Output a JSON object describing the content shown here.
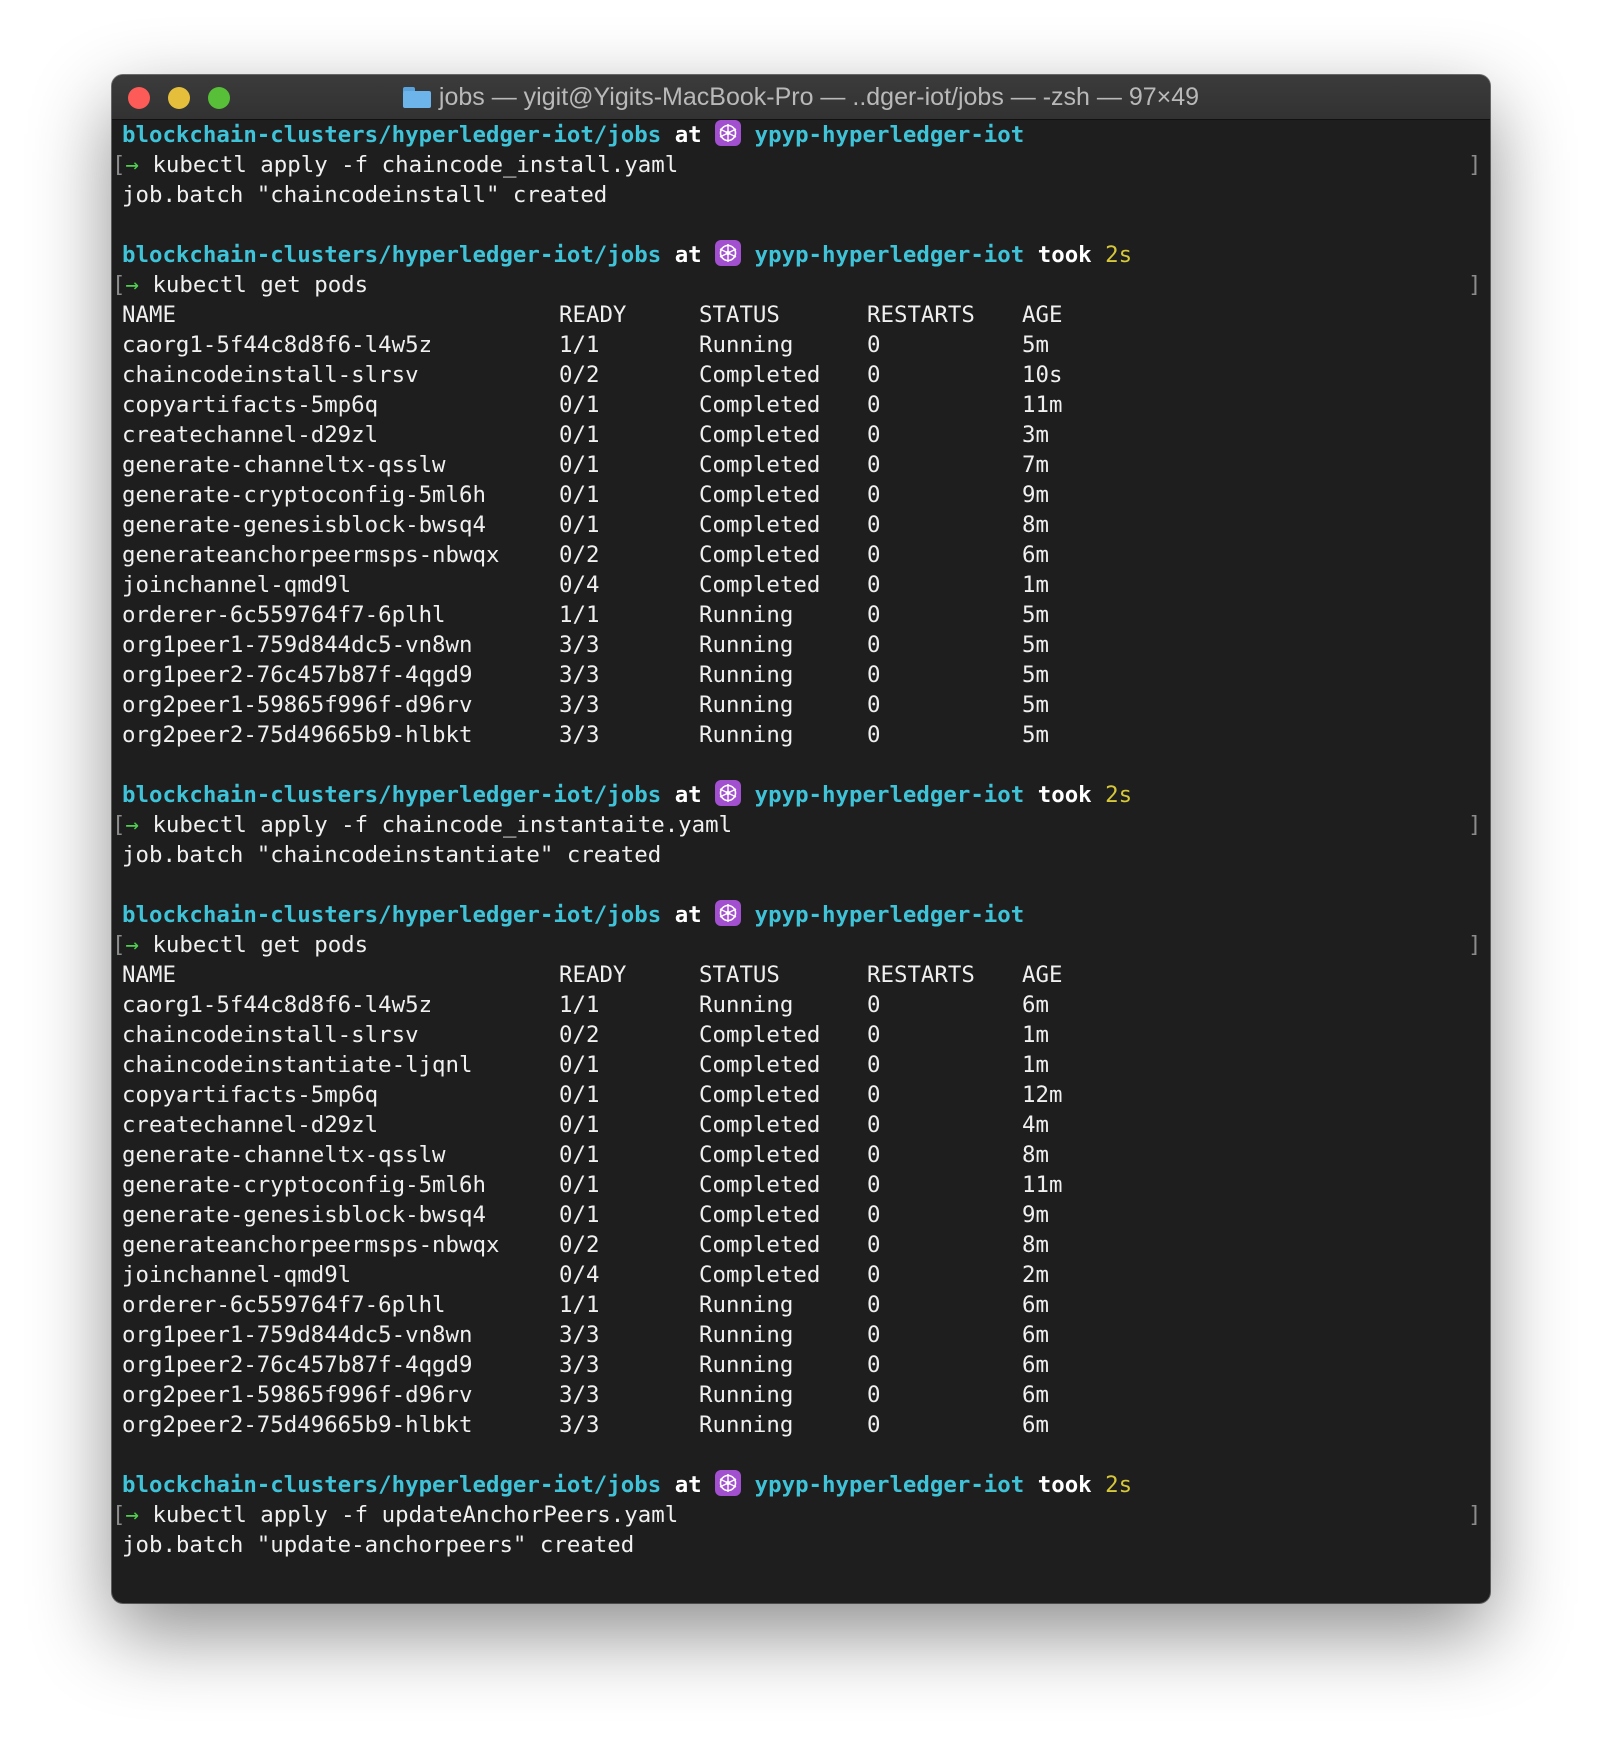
{
  "window": {
    "title": "jobs — yigit@Yigits-MacBook-Pro — ..dger-iot/jobs — -zsh — 97×49",
    "title_icon": "folder-icon"
  },
  "prompt": {
    "path": "blockchain-clusters/hyperledger-iot/jobs",
    "at": "at",
    "context": "ypyp-hyperledger-iot",
    "took": "took",
    "duration": "2s",
    "arrow": "→",
    "context_icon": "kubernetes-icon"
  },
  "table_headers": [
    "NAME",
    "READY",
    "STATUS",
    "RESTARTS",
    "AGE"
  ],
  "blocks": [
    {
      "show_took": false,
      "command": "kubectl apply -f chaincode_install.yaml",
      "output": "job.batch \"chaincodeinstall\" created"
    },
    {
      "show_took": true,
      "command": "kubectl get pods",
      "rows": [
        [
          "caorg1-5f44c8d8f6-l4w5z",
          "1/1",
          "Running",
          "0",
          "5m"
        ],
        [
          "chaincodeinstall-slrsv",
          "0/2",
          "Completed",
          "0",
          "10s"
        ],
        [
          "copyartifacts-5mp6q",
          "0/1",
          "Completed",
          "0",
          "11m"
        ],
        [
          "createchannel-d29zl",
          "0/1",
          "Completed",
          "0",
          "3m"
        ],
        [
          "generate-channeltx-qsslw",
          "0/1",
          "Completed",
          "0",
          "7m"
        ],
        [
          "generate-cryptoconfig-5ml6h",
          "0/1",
          "Completed",
          "0",
          "9m"
        ],
        [
          "generate-genesisblock-bwsq4",
          "0/1",
          "Completed",
          "0",
          "8m"
        ],
        [
          "generateanchorpeermsps-nbwqx",
          "0/2",
          "Completed",
          "0",
          "6m"
        ],
        [
          "joinchannel-qmd9l",
          "0/4",
          "Completed",
          "0",
          "1m"
        ],
        [
          "orderer-6c559764f7-6plhl",
          "1/1",
          "Running",
          "0",
          "5m"
        ],
        [
          "org1peer1-759d844dc5-vn8wn",
          "3/3",
          "Running",
          "0",
          "5m"
        ],
        [
          "org1peer2-76c457b87f-4qgd9",
          "3/3",
          "Running",
          "0",
          "5m"
        ],
        [
          "org2peer1-59865f996f-d96rv",
          "3/3",
          "Running",
          "0",
          "5m"
        ],
        [
          "org2peer2-75d49665b9-hlbkt",
          "3/3",
          "Running",
          "0",
          "5m"
        ]
      ]
    },
    {
      "show_took": true,
      "command": "kubectl apply -f chaincode_instantaite.yaml",
      "output": "job.batch \"chaincodeinstantiate\" created"
    },
    {
      "show_took": false,
      "command": "kubectl get pods",
      "rows": [
        [
          "caorg1-5f44c8d8f6-l4w5z",
          "1/1",
          "Running",
          "0",
          "6m"
        ],
        [
          "chaincodeinstall-slrsv",
          "0/2",
          "Completed",
          "0",
          "1m"
        ],
        [
          "chaincodeinstantiate-ljqnl",
          "0/1",
          "Completed",
          "0",
          "1m"
        ],
        [
          "copyartifacts-5mp6q",
          "0/1",
          "Completed",
          "0",
          "12m"
        ],
        [
          "createchannel-d29zl",
          "0/1",
          "Completed",
          "0",
          "4m"
        ],
        [
          "generate-channeltx-qsslw",
          "0/1",
          "Completed",
          "0",
          "8m"
        ],
        [
          "generate-cryptoconfig-5ml6h",
          "0/1",
          "Completed",
          "0",
          "11m"
        ],
        [
          "generate-genesisblock-bwsq4",
          "0/1",
          "Completed",
          "0",
          "9m"
        ],
        [
          "generateanchorpeermsps-nbwqx",
          "0/2",
          "Completed",
          "0",
          "8m"
        ],
        [
          "joinchannel-qmd9l",
          "0/4",
          "Completed",
          "0",
          "2m"
        ],
        [
          "orderer-6c559764f7-6plhl",
          "1/1",
          "Running",
          "0",
          "6m"
        ],
        [
          "org1peer1-759d844dc5-vn8wn",
          "3/3",
          "Running",
          "0",
          "6m"
        ],
        [
          "org1peer2-76c457b87f-4qgd9",
          "3/3",
          "Running",
          "0",
          "6m"
        ],
        [
          "org2peer1-59865f996f-d96rv",
          "3/3",
          "Running",
          "0",
          "6m"
        ],
        [
          "org2peer2-75d49665b9-hlbkt",
          "3/3",
          "Running",
          "0",
          "6m"
        ]
      ]
    },
    {
      "show_took": true,
      "command": "kubectl apply -f updateAnchorPeers.yaml",
      "output": "job.batch \"update-anchorpeers\" created"
    }
  ]
}
